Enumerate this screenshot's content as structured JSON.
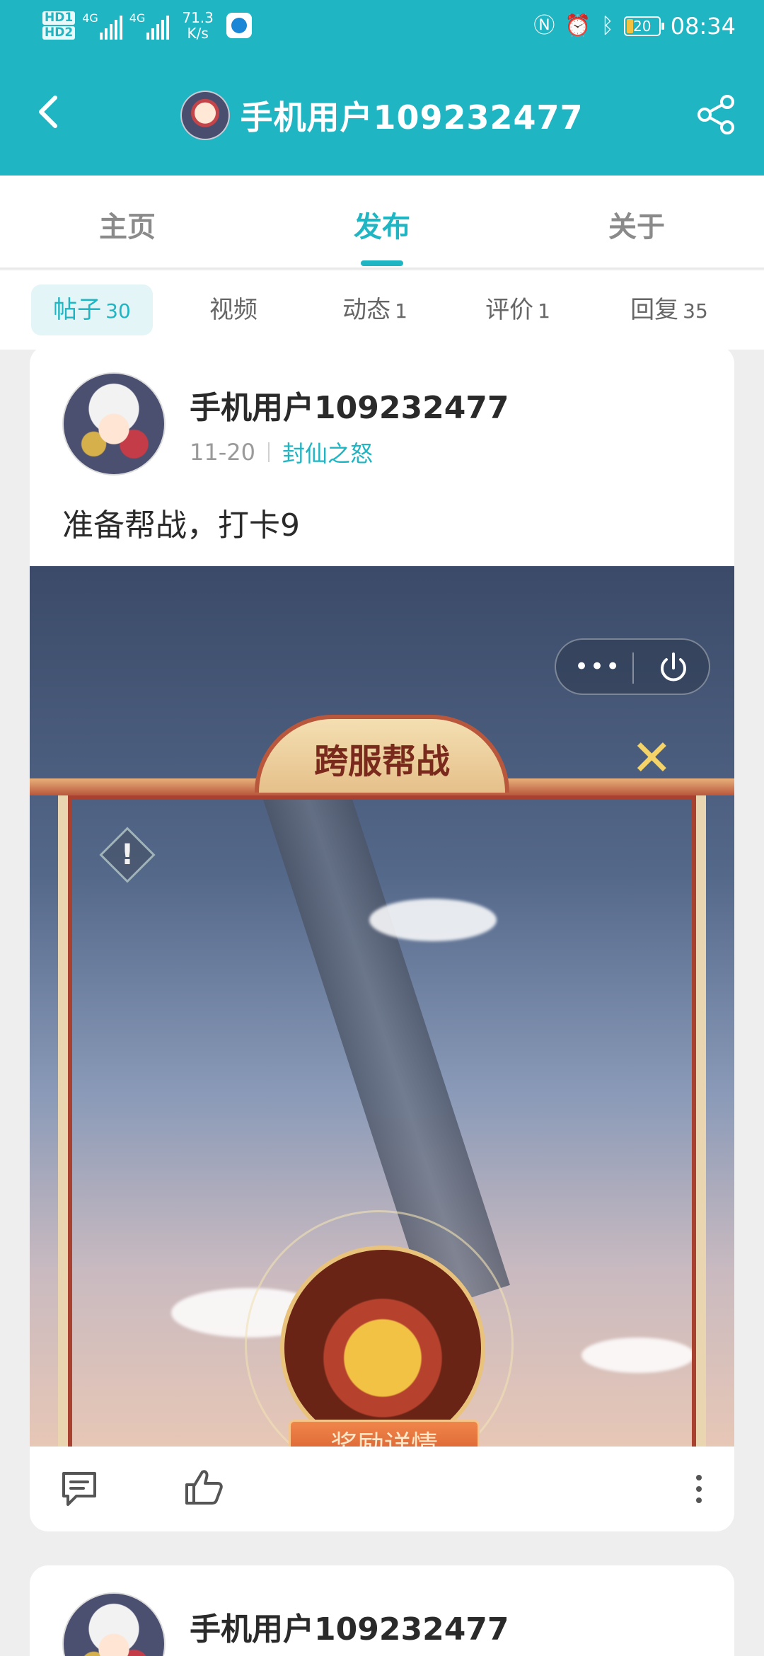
{
  "status_bar": {
    "hd1": "HD",
    "hd1_sub": "1",
    "hd2": "HD",
    "hd2_sub": "2",
    "net1": "4G",
    "net2": "4G",
    "speed_value": "71.3",
    "speed_unit": "K/s",
    "battery": "20",
    "time": "08:34"
  },
  "header": {
    "title": "手机用户109232477"
  },
  "tabs": [
    {
      "label": "主页"
    },
    {
      "label": "发布"
    },
    {
      "label": "关于"
    }
  ],
  "chips": [
    {
      "label": "帖子",
      "count": "30"
    },
    {
      "label": "视频",
      "count": ""
    },
    {
      "label": "动态",
      "count": "1"
    },
    {
      "label": "评价",
      "count": "1"
    },
    {
      "label": "回复",
      "count": "35"
    }
  ],
  "post": {
    "author": "手机用户109232477",
    "date": "11-20",
    "game": "封仙之怒",
    "text": "准备帮战，打卡9",
    "image": {
      "banner": "跨服帮战",
      "menu_dots": "•••",
      "reward_button": "奖励详情",
      "warn_mark": "!",
      "close_mark": "✕"
    }
  },
  "post2": {
    "author": "手机用户109232477"
  },
  "colors": {
    "primary": "#1fb5c3",
    "background": "#eeeeee"
  },
  "icons": {
    "back": "chevron-left-icon",
    "share": "share-icon",
    "comment": "comment-icon",
    "like": "thumbs-up-icon",
    "more": "more-vertical-icon"
  }
}
